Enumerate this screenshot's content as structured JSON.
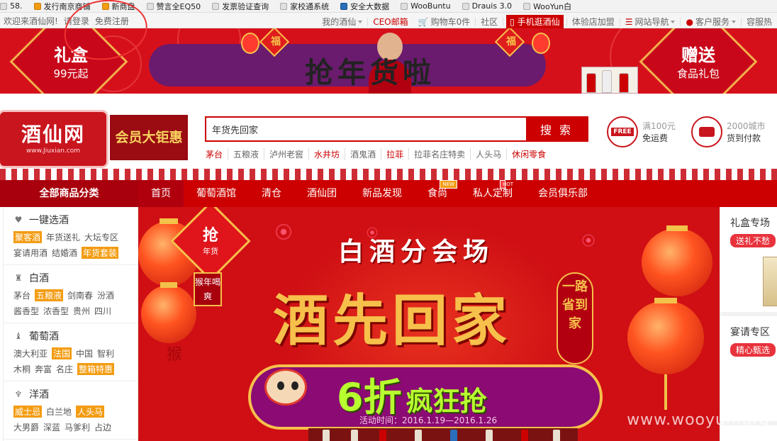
{
  "bookmarks": [
    {
      "label": "58.",
      "icon": "page-icon"
    },
    {
      "label": "发行南京商铺",
      "icon": "weather-icon"
    },
    {
      "label": "新商盘",
      "icon": "weather-icon"
    },
    {
      "label": "赞言全EQ50",
      "icon": "page-icon"
    },
    {
      "label": "发票验证查询",
      "icon": "page-icon"
    },
    {
      "label": "家校通系统",
      "icon": "page-icon"
    },
    {
      "label": "安全大数据",
      "icon": "word-icon"
    },
    {
      "label": "WooBuntu",
      "icon": "page-icon"
    },
    {
      "label": "Drauis 3.0",
      "icon": "page-icon"
    },
    {
      "label": "WooYun白",
      "icon": "page-icon"
    }
  ],
  "topnav": {
    "welcome": "欢迎来酒仙网!",
    "login": "请登录",
    "register": "免费注册",
    "my_account": "我的酒仙",
    "ceo_mail": "CEO邮箱",
    "cart": "购物车0件",
    "community": "社区",
    "mobile": "手机逛酒仙",
    "store": "体验店加盟",
    "site_nav": "网站导航",
    "service": "客户服务",
    "more": "容服热"
  },
  "promo": {
    "left_big": "礼盒",
    "left_small": "99元起",
    "slogan": "抢年货啦",
    "fu": "福",
    "right_big": "赠送",
    "right_small": "食品礼包"
  },
  "header": {
    "logo_cn": "酒仙网",
    "logo_en": "www.Jiuxian.com",
    "vip": "会员大钜惠",
    "search_value": "年货先回家",
    "search_button": "搜 索",
    "hot_keywords": [
      {
        "text": "茅台",
        "red": true
      },
      {
        "text": "五粮液",
        "red": false
      },
      {
        "text": "泸州老窖",
        "red": false
      },
      {
        "text": "水井坊",
        "red": true
      },
      {
        "text": "酒鬼酒",
        "red": false
      },
      {
        "text": "拉菲",
        "red": true
      },
      {
        "text": "拉菲名庄特卖",
        "red": false
      },
      {
        "text": "人头马",
        "red": false
      },
      {
        "text": "休闲零食",
        "red": true
      }
    ],
    "free_tag": "FREE",
    "free_line1": "满100元",
    "free_line2": "免运费",
    "cod_line1": "2000城市",
    "cod_line2": "货到付款"
  },
  "mainnav": {
    "all_categories": "全部商品分类",
    "items": [
      {
        "label": "首页",
        "badge": ""
      },
      {
        "label": "葡萄酒馆",
        "badge": ""
      },
      {
        "label": "清仓",
        "badge": ""
      },
      {
        "label": "酒仙团",
        "badge": "HOT"
      },
      {
        "label": "新品发现",
        "badge": ""
      },
      {
        "label": "食尚",
        "badge": "NEW"
      },
      {
        "label": "私人定制",
        "badge": ""
      },
      {
        "label": "会员俱乐部",
        "badge": ""
      }
    ]
  },
  "sidebar": [
    {
      "title": "一键选酒",
      "icon": "heart-icon",
      "rows": [
        [
          {
            "t": "聚客酒",
            "hl": true
          },
          {
            "t": "年货送礼",
            "hl": false
          },
          {
            "t": "大坛专区",
            "hl": false
          }
        ],
        [
          {
            "t": "宴请用酒",
            "hl": false
          },
          {
            "t": "结婚酒",
            "hl": false
          },
          {
            "t": "年货套装",
            "hl": true
          }
        ]
      ]
    },
    {
      "title": "白酒",
      "icon": "bottle-icon",
      "rows": [
        [
          {
            "t": "茅台",
            "hl": false
          },
          {
            "t": "五粮液",
            "hl": true
          },
          {
            "t": "剑南春",
            "hl": false
          },
          {
            "t": "汾酒",
            "hl": false
          }
        ],
        [
          {
            "t": "酱香型",
            "hl": false
          },
          {
            "t": "浓香型",
            "hl": false
          },
          {
            "t": "贵州",
            "hl": false
          },
          {
            "t": "四川",
            "hl": false
          }
        ]
      ]
    },
    {
      "title": "葡萄酒",
      "icon": "wine-bottle-icon",
      "rows": [
        [
          {
            "t": "澳大利亚",
            "hl": false
          },
          {
            "t": "法国",
            "hl": true
          },
          {
            "t": "中国",
            "hl": false
          },
          {
            "t": "智利",
            "hl": false
          }
        ],
        [
          {
            "t": "木桐",
            "hl": false
          },
          {
            "t": "奔富",
            "hl": false
          },
          {
            "t": "名庄",
            "hl": false
          },
          {
            "t": "整箱特惠",
            "hl": true
          }
        ]
      ]
    },
    {
      "title": "洋酒",
      "icon": "cocktail-icon",
      "rows": [
        [
          {
            "t": "威士忌",
            "hl": true
          },
          {
            "t": "白兰地",
            "hl": false
          },
          {
            "t": "人头马",
            "hl": true
          }
        ],
        [
          {
            "t": "大男爵",
            "hl": false
          },
          {
            "t": "深蓝",
            "hl": false
          },
          {
            "t": "马爹利",
            "hl": false
          },
          {
            "t": "占边",
            "hl": false
          }
        ]
      ]
    }
  ],
  "banner": {
    "grab": "抢",
    "grab_sub": "年货",
    "year_tag": "猴年喝爽",
    "title": "白酒分会场",
    "main": "酒先回家",
    "side": "一路省到家",
    "discount": "6折",
    "discount_text": "疯狂抢",
    "time": "活动时间：2016.1.19—2016.1.26",
    "monkey": "猴"
  },
  "rightcol": [
    {
      "title": "礼盒专场",
      "tag": "送礼不愁"
    },
    {
      "title": "宴请专区",
      "tag": "精心甄选"
    }
  ],
  "watermark": "www.wooyun.org"
}
